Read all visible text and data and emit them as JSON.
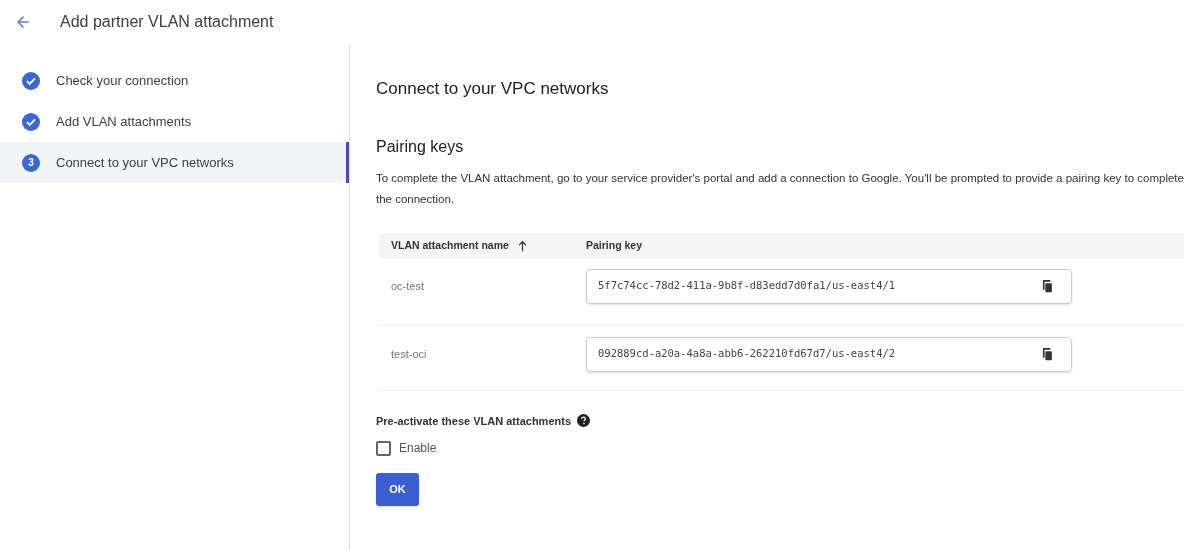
{
  "header": {
    "title": "Add partner VLAN attachment"
  },
  "steps": [
    {
      "label": "Check your connection",
      "kind": "done",
      "selected": false
    },
    {
      "label": "Add VLAN attachments",
      "kind": "done",
      "selected": false
    },
    {
      "label": "Connect to your VPC networks",
      "kind": "current",
      "number": "3",
      "selected": true
    }
  ],
  "main": {
    "heading": "Connect to your VPC networks",
    "section_title": "Pairing keys",
    "description": "To complete the VLAN attachment, go to your service provider's portal and add a connection to Google. You'll be prompted to provide a pairing key to complete the connection."
  },
  "table": {
    "columns": [
      {
        "label": "VLAN attachment name",
        "sorted": true
      },
      {
        "label": "Pairing key",
        "sorted": false
      }
    ],
    "rows": [
      {
        "name": "oc-test",
        "pairing_key": "5f7c74cc-78d2-411a-9b8f-d83edd7d0fa1/us-east4/1"
      },
      {
        "name": "test-oci",
        "pairing_key": "092889cd-a20a-4a8a-abb6-262210fd67d7/us-east4/2"
      }
    ]
  },
  "preactivate": {
    "label": "Pre-activate these VLAN attachments",
    "checkbox_label": "Enable",
    "checked": false
  },
  "buttons": [
    {
      "label": "OK"
    }
  ]
}
